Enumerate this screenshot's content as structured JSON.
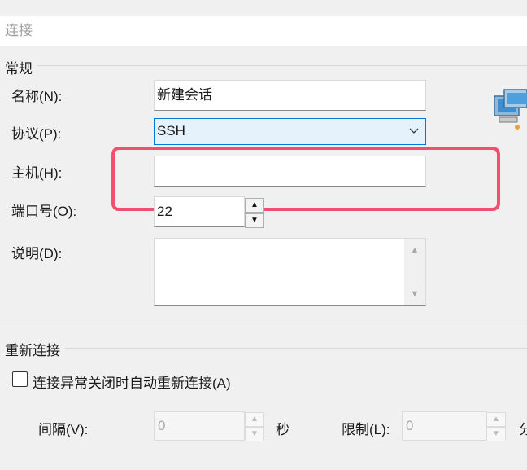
{
  "section": {
    "title": "连接"
  },
  "general": {
    "title": "常规",
    "name_label": "名称(N):",
    "name_value": "新建会话",
    "protocol_label": "协议(P):",
    "protocol_value": "SSH",
    "host_label": "主机(H):",
    "host_value": "",
    "port_label": "端口号(O):",
    "port_value": "22",
    "desc_label": "说明(D):",
    "desc_value": ""
  },
  "reconnect": {
    "title": "重新连接",
    "checkbox_label": "连接异常关闭时自动重新连接(A)",
    "checkbox_checked": false,
    "interval_label": "间隔(V):",
    "interval_value": "0",
    "interval_unit": "秒",
    "limit_label": "限制(L):",
    "limit_value": "0",
    "limit_unit": "分"
  },
  "icons": {
    "network": "network-computers-icon",
    "chevron": "chevron-down-icon",
    "spin_up": "spin-up-icon",
    "spin_down": "spin-down-icon"
  },
  "colors": {
    "highlight": "#f0506e",
    "combo_bg": "#e5f1fb",
    "combo_border": "#0078d7"
  }
}
